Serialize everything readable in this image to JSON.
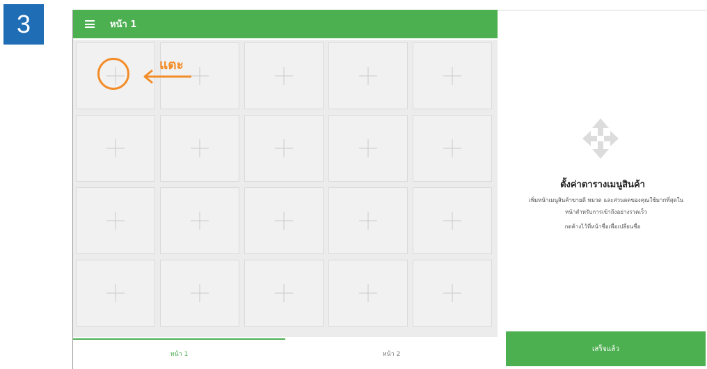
{
  "step": {
    "number": "3"
  },
  "header": {
    "title": "หน้า 1",
    "menu_icon": "hamburger-menu-icon"
  },
  "grid": {
    "rows": 4,
    "columns": 5,
    "tile_icon": "plus-icon"
  },
  "annotation": {
    "label": "แตะ",
    "color": "#f28c28"
  },
  "tabs": [
    {
      "label": "หน้า 1",
      "active": true
    },
    {
      "label": "หน้า 2",
      "active": false
    }
  ],
  "panel": {
    "icon": "move-arrows-icon",
    "title": "ตั้งค่าตารางเมนูสินค้า",
    "description_line1": "เพิ่มหน้าเมนูสินค้าขายดี หมวด และส่วนลดของคุณใช้มากที่สุดใน",
    "description_line2": "หน้าสำหรับการเข้าถึงอย่างรวดเร็ว",
    "hint": "กดค้างไว้ที่หน้าชื่อเพื่อเปลี่ยนชื่อ"
  },
  "done_button": {
    "label": "เสร็จแล้ว"
  },
  "colors": {
    "accent": "#4caf50",
    "step_badge": "#1f6db5",
    "annotation": "#f28c28"
  }
}
